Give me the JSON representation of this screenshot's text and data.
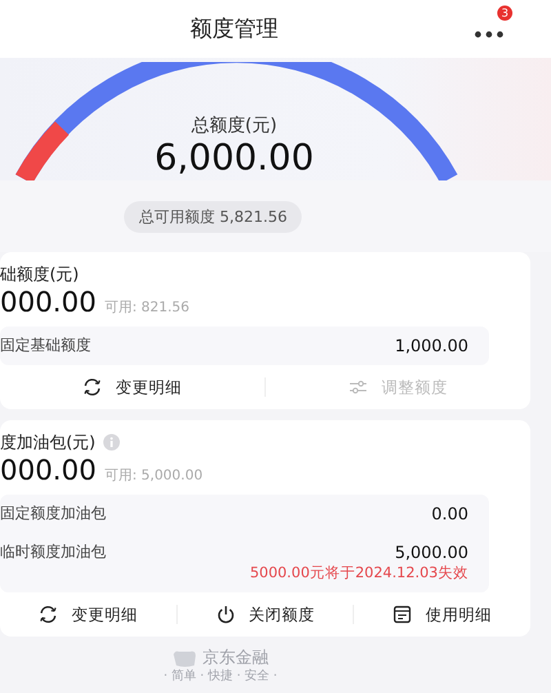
{
  "header": {
    "title": "额度管理",
    "badge": "3"
  },
  "gauge": {
    "label": "总额度(元)",
    "amount": "6,000.00",
    "available": "总可用额度 5,821.56"
  },
  "cards": [
    {
      "title": "础额度(元)",
      "info": false,
      "amount": "000.00",
      "available": "可用: 821.56",
      "rows": [
        {
          "label": "固定基础额度",
          "value": "1,000.00"
        }
      ],
      "actions": [
        {
          "kind": "refresh",
          "label": "变更明细",
          "disabled": false
        },
        {
          "kind": "sliders",
          "label": "调整额度",
          "disabled": true
        }
      ]
    },
    {
      "title": "度加油包(元)",
      "info": true,
      "amount": "000.00",
      "available": "可用: 5,000.00",
      "rows": [
        {
          "label": "固定额度加油包",
          "value": "0.00"
        },
        {
          "label": "临时额度加油包",
          "value": "5,000.00",
          "note": "5000.00元将于2024.12.03失效"
        }
      ],
      "actions": [
        {
          "kind": "refresh",
          "label": "变更明细",
          "disabled": false
        },
        {
          "kind": "power",
          "label": "关闭额度",
          "disabled": false
        },
        {
          "kind": "receipt",
          "label": "使用明细",
          "disabled": false
        }
      ]
    }
  ],
  "footer": {
    "brand": "京东金融",
    "slogan": "· 简单 · 快捷 · 安全 ·"
  }
}
